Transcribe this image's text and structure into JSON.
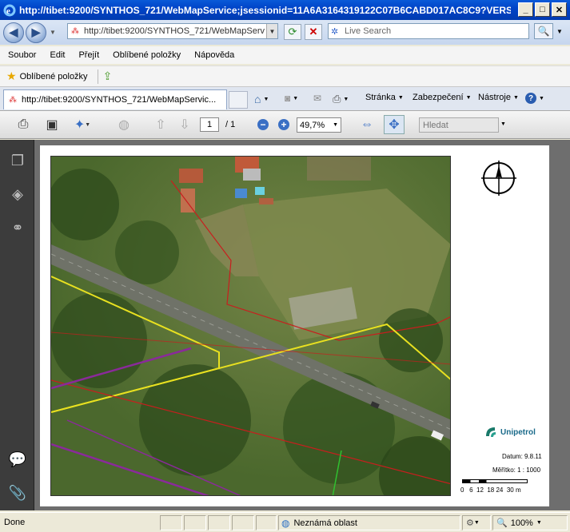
{
  "window": {
    "title": "http://tibet:9200/SYNTHOS_721/WebMapService;jsessionid=11A6A3164319122C07B6CABD017AC8C9?VERSI..."
  },
  "address": {
    "url": "http://tibet:9200/SYNTHOS_721/WebMapServ"
  },
  "search": {
    "placeholder": "Live Search"
  },
  "menu": [
    "Soubor",
    "Edit",
    "Přejít",
    "Oblíbené položky",
    "Nápověda"
  ],
  "favorites": {
    "label": "Oblíbené položky"
  },
  "tab": {
    "title": "http://tibet:9200/SYNTHOS_721/WebMapServic..."
  },
  "commands": {
    "page": "Stránka",
    "security": "Zabezpečení",
    "tools": "Nástroje"
  },
  "pdf": {
    "page_current": "1",
    "page_total": "/ 1",
    "zoom": "49,7%",
    "find_placeholder": "Hledat"
  },
  "map": {
    "logo_text": "Unipetrol",
    "date_label": "Datum: 9.8.11",
    "scale_label": "Měřítko: 1 : 1000",
    "scale_ticks": "0   6  12  18 24  30 m"
  },
  "status": {
    "left": "Done",
    "zone": "Neznámá oblast",
    "zoom": "100%"
  }
}
